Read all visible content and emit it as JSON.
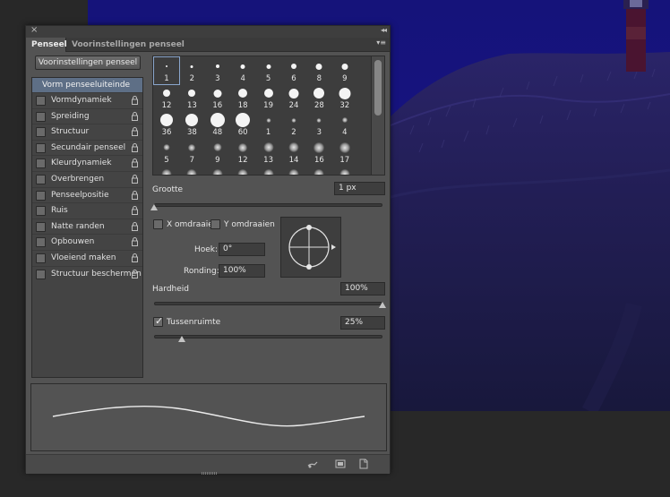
{
  "panel": {
    "close_glyph": "×",
    "collapse_glyph": "◂◂",
    "menu_glyph": "▾≡",
    "tabs": [
      {
        "label": "Penseel",
        "active": true
      },
      {
        "label": "Voorinstellingen penseel",
        "active": false
      }
    ],
    "preset_button": "Voorinstellingen penseel"
  },
  "options": {
    "header": "Vorm penseeluiteinde",
    "items": [
      {
        "label": "Vormdynamiek",
        "checked": false,
        "lock_icon": "lock-icon"
      },
      {
        "label": "Spreiding",
        "checked": false,
        "lock_icon": "lock-icon"
      },
      {
        "label": "Structuur",
        "checked": false,
        "lock_icon": "lock-icon"
      },
      {
        "label": "Secundair penseel",
        "checked": false,
        "lock_icon": "lock-icon"
      },
      {
        "label": "Kleurdynamiek",
        "checked": false,
        "lock_icon": "lock-icon"
      },
      {
        "label": "Overbrengen",
        "checked": false,
        "lock_icon": "lock-icon"
      },
      {
        "label": "Penseelpositie",
        "checked": false,
        "lock_icon": "lock-icon"
      },
      {
        "label": "Ruis",
        "checked": false,
        "lock_icon": "lock-icon"
      },
      {
        "label": "Natte randen",
        "checked": false,
        "lock_icon": "lock-icon"
      },
      {
        "label": "Opbouwen",
        "checked": false,
        "lock_icon": "lock-icon"
      },
      {
        "label": "Vloeiend maken",
        "checked": false,
        "lock_icon": "lock-icon"
      },
      {
        "label": "Structuur beschermen",
        "checked": false,
        "lock_icon": "lock-icon"
      }
    ]
  },
  "brush_tips": [
    {
      "size": "1",
      "style": "hard"
    },
    {
      "size": "2",
      "style": "hard"
    },
    {
      "size": "3",
      "style": "hard"
    },
    {
      "size": "4",
      "style": "hard"
    },
    {
      "size": "5",
      "style": "hard"
    },
    {
      "size": "6",
      "style": "hard"
    },
    {
      "size": "8",
      "style": "hard"
    },
    {
      "size": "9",
      "style": "hard"
    },
    {
      "size": "12",
      "style": "hard"
    },
    {
      "size": "13",
      "style": "hard"
    },
    {
      "size": "16",
      "style": "hard"
    },
    {
      "size": "18",
      "style": "hard"
    },
    {
      "size": "19",
      "style": "hard"
    },
    {
      "size": "24",
      "style": "hard"
    },
    {
      "size": "28",
      "style": "hard"
    },
    {
      "size": "32",
      "style": "hard"
    },
    {
      "size": "36",
      "style": "hard"
    },
    {
      "size": "38",
      "style": "hard"
    },
    {
      "size": "48",
      "style": "hard"
    },
    {
      "size": "60",
      "style": "hard"
    },
    {
      "size": "1",
      "style": "soft"
    },
    {
      "size": "2",
      "style": "soft"
    },
    {
      "size": "3",
      "style": "soft"
    },
    {
      "size": "4",
      "style": "soft"
    },
    {
      "size": "5",
      "style": "soft"
    },
    {
      "size": "7",
      "style": "soft"
    },
    {
      "size": "9",
      "style": "soft"
    },
    {
      "size": "12",
      "style": "soft"
    },
    {
      "size": "13",
      "style": "soft"
    },
    {
      "size": "14",
      "style": "soft"
    },
    {
      "size": "16",
      "style": "soft"
    },
    {
      "size": "17",
      "style": "soft"
    },
    {
      "size": "",
      "style": "soft"
    },
    {
      "size": "",
      "style": "soft"
    },
    {
      "size": "",
      "style": "soft"
    },
    {
      "size": "",
      "style": "soft"
    },
    {
      "size": "",
      "style": "soft"
    },
    {
      "size": "",
      "style": "soft"
    },
    {
      "size": "",
      "style": "soft"
    },
    {
      "size": "",
      "style": "soft"
    }
  ],
  "brush_settings": {
    "size_label": "Grootte",
    "size_value": "1 px",
    "size_slider_fraction": 0.0,
    "flip_x_label": "X omdraaien",
    "flip_x_checked": false,
    "flip_y_label": "Y omdraaien",
    "flip_y_checked": false,
    "angle_label": "Hoek:",
    "angle_value": "0°",
    "roundness_label": "Ronding:",
    "roundness_value": "100%",
    "hardness_label": "Hardheid",
    "hardness_value": "100%",
    "hardness_slider_fraction": 1.0,
    "spacing_label": "Tussenruimte",
    "spacing_checked": true,
    "spacing_value": "25%",
    "spacing_slider_fraction": 0.12
  },
  "bottom_icons": [
    "brush-toggle-icon",
    "new-preset-icon",
    "new-brush-icon"
  ],
  "colors": {
    "panel_bg": "#535353",
    "selected_header": "#5e6f86",
    "photo_sky": "#16137e"
  }
}
